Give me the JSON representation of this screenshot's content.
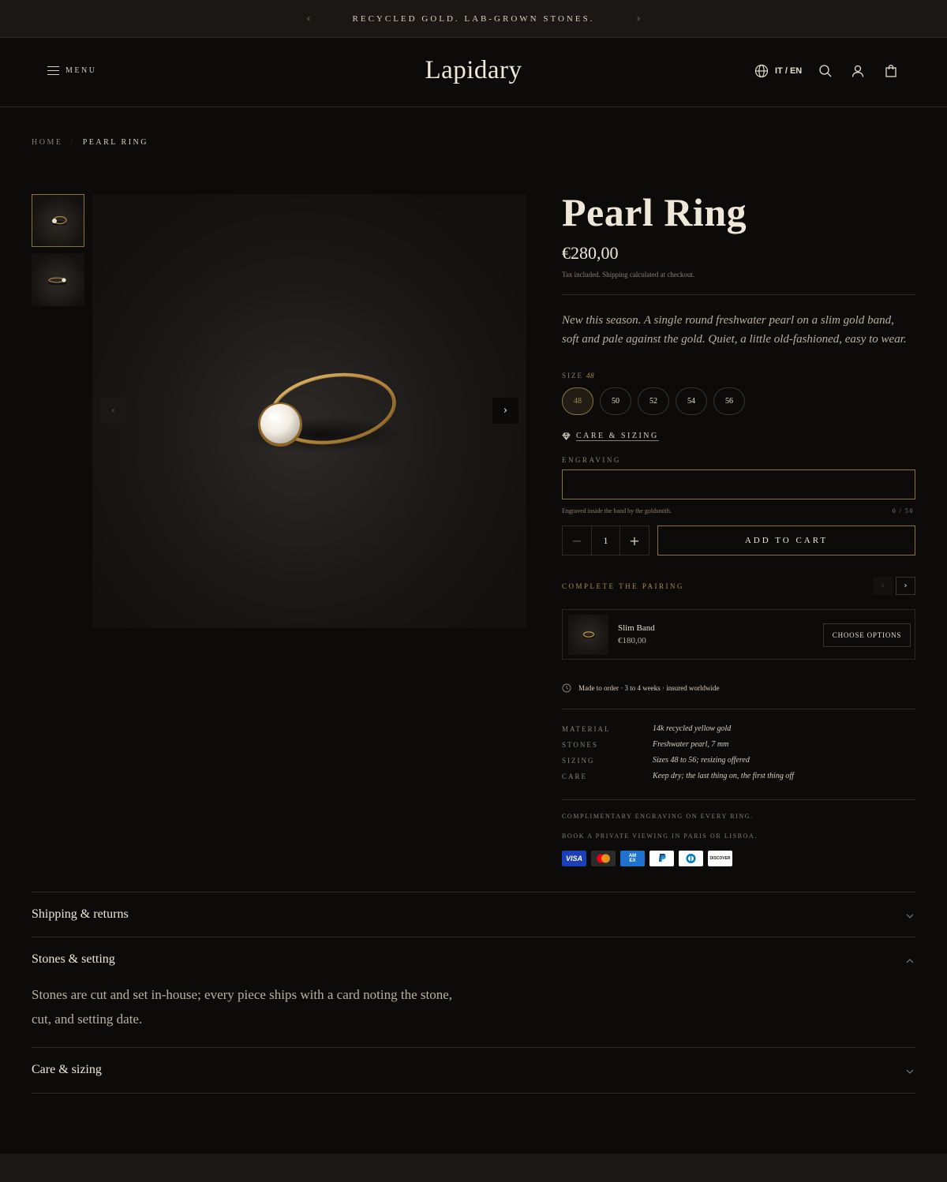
{
  "announcement": {
    "text": "RECYCLED GOLD. LAB-GROWN STONES."
  },
  "header": {
    "menu_label": "MENU",
    "logo": "Lapidary",
    "lang_label": "IT / EN"
  },
  "breadcrumb": {
    "home": "HOME",
    "separator": "/",
    "current": "PEARL RING"
  },
  "product": {
    "title": "Pearl Ring",
    "price": "€280,00",
    "tax_note": "Tax included. Shipping calculated at checkout.",
    "description": "New this season. A single round freshwater pearl on a slim gold band, soft and pale against the gold. Quiet, a little old-fashioned, easy to wear.",
    "size_label": "SIZE",
    "selected_size": "48",
    "sizes": [
      "48",
      "50",
      "52",
      "54",
      "56"
    ],
    "care_link": "CARE & SIZING",
    "engraving_label": "ENGRAVING",
    "engraving_value": "",
    "engraving_note": "Engraved inside the band by the goldsmith.",
    "engraving_count": "0 / 50",
    "quantity": "1",
    "add_to_cart": "ADD TO CART"
  },
  "pairing": {
    "label": "COMPLETE THE PAIRING",
    "item_name": "Slim Band",
    "item_price": "€180,00",
    "button": "CHOOSE OPTIONS"
  },
  "shipping_note": "Made to order · 3 to 4 weeks · insured worldwide",
  "specs": [
    {
      "key": "MATERIAL",
      "value": "14k recycled yellow gold"
    },
    {
      "key": "STONES",
      "value": "Freshwater pearl, 7 mm"
    },
    {
      "key": "SIZING",
      "value": "Sizes 48 to 56; resizing offered"
    },
    {
      "key": "CARE",
      "value": "Keep dry; the last thing on, the first thing off"
    }
  ],
  "promos": [
    "COMPLIMENTARY ENGRAVING ON EVERY RING.",
    "BOOK A PRIVATE VIEWING IN PARIS OR LISBOA."
  ],
  "payments": {
    "visa": "VISA",
    "amex": "AM EX",
    "discover": "DISCOVER"
  },
  "accordion": [
    {
      "title": "Shipping & returns",
      "open": false
    },
    {
      "title": "Stones & setting",
      "open": true,
      "body": "Stones are cut and set in-house; every piece ships with a card noting the stone, cut, and setting date."
    },
    {
      "title": "Care & sizing",
      "open": false
    }
  ],
  "colors": {
    "background": "#0d0b09",
    "gold_accent": "#8a7340",
    "text": "#efe7d8",
    "muted": "#8a8171"
  }
}
